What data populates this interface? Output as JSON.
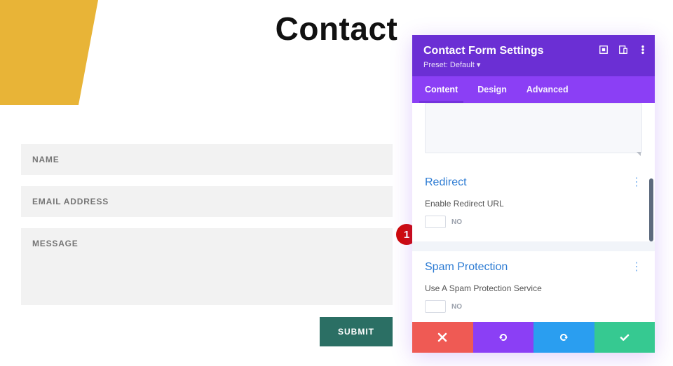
{
  "page": {
    "title": "Contact"
  },
  "form": {
    "name_placeholder": "NAME",
    "email_placeholder": "EMAIL ADDRESS",
    "message_placeholder": "MESSAGE",
    "submit_label": "SUBMIT"
  },
  "panel": {
    "title": "Contact Form Settings",
    "preset_label": "Preset: Default ▾",
    "tabs": [
      "Content",
      "Design",
      "Advanced"
    ],
    "sections": {
      "redirect": {
        "title": "Redirect",
        "option_label": "Enable Redirect URL",
        "toggle_value": "NO"
      },
      "spam": {
        "title": "Spam Protection",
        "option_label": "Use A Spam Protection Service",
        "toggle_value": "NO"
      }
    }
  },
  "marker": {
    "step": "1"
  }
}
